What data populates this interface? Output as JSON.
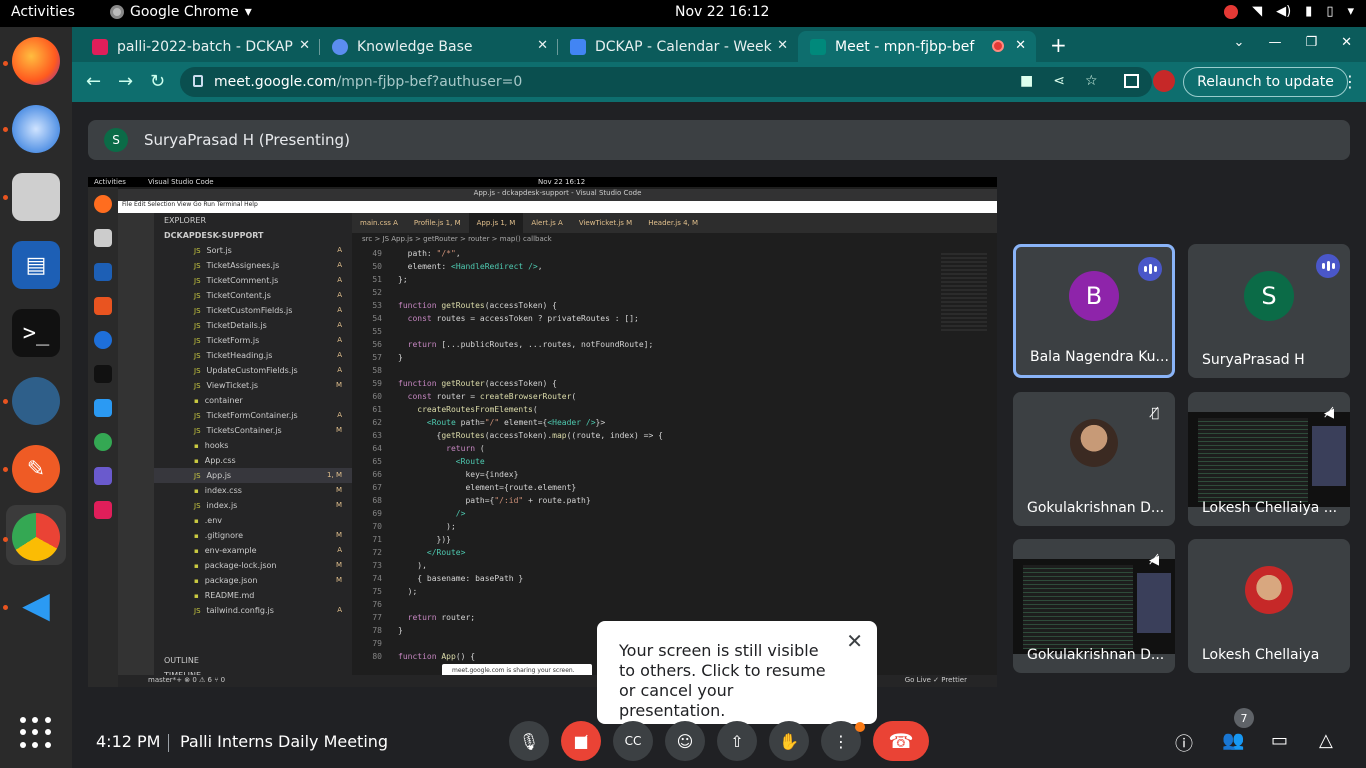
{
  "os": {
    "activities": "Activities",
    "app_name": "Google Chrome",
    "clock": "Nov 22  16:12"
  },
  "browser": {
    "tabs": [
      {
        "title": "palli-2022-batch - DCKAP",
        "color": "#e01e5a"
      },
      {
        "title": "Knowledge Base",
        "color": "#5b8def"
      },
      {
        "title": "DCKAP - Calendar - Week",
        "color": "#4285f4"
      },
      {
        "title": "Meet - mpn-fjbp-bef",
        "color": "#00897b"
      }
    ],
    "url_host": "meet.google.com",
    "url_path": "/mpn-fjbp-bef?authuser=0",
    "relaunch_label": "Relaunch to update"
  },
  "meet": {
    "presenter_initial": "S",
    "presenter_label": "SuryaPrasad H (Presenting)",
    "participants": [
      {
        "name": "Bala Nagendra Ku...",
        "initial": "B",
        "avatar_color": "#8e24aa"
      },
      {
        "name": "SuryaPrasad H",
        "initial": "S",
        "avatar_color": "#0b6b47"
      },
      {
        "name": "Gokulakrishnan D..."
      },
      {
        "name": "Lokesh Chellaiya ..."
      },
      {
        "name": "Gokulakrishnan D..."
      },
      {
        "name": "Lokesh Chellaiya"
      }
    ],
    "popup_text": "Your screen is still visible to others. Click to resume or cancel your presentation.",
    "time": "4:12 PM",
    "meeting_name": "Palli Interns Daily Meeting",
    "participant_count": "7"
  },
  "shared_screen": {
    "top_left": "Activities",
    "app": "Visual Studio Code",
    "clock": "Nov 22  16:12",
    "title": "App.js - dckapdesk-support - Visual Studio Code",
    "menu": "File  Edit  Selection  View  Go  Run  Terminal  Help",
    "explorer_title": "EXPLORER",
    "project": "DCKAPDESK-SUPPORT",
    "files": [
      {
        "name": "Sort.js",
        "status": "A"
      },
      {
        "name": "TicketAssignees.js",
        "status": "A"
      },
      {
        "name": "TicketComment.js",
        "status": "A"
      },
      {
        "name": "TicketContent.js",
        "status": "A"
      },
      {
        "name": "TicketCustomFields.js",
        "status": "A"
      },
      {
        "name": "TicketDetails.js",
        "status": "A"
      },
      {
        "name": "TicketForm.js",
        "status": "A"
      },
      {
        "name": "TicketHeading.js",
        "status": "A"
      },
      {
        "name": "UpdateCustomFields.js",
        "status": "A"
      },
      {
        "name": "ViewTicket.js",
        "status": "M"
      },
      {
        "name": "container",
        "status": ""
      },
      {
        "name": "TicketFormContainer.js",
        "status": "A"
      },
      {
        "name": "TicketsContainer.js",
        "status": "M"
      },
      {
        "name": "hooks",
        "status": ""
      },
      {
        "name": "App.css",
        "status": ""
      },
      {
        "name": "App.js",
        "status": "1, M"
      },
      {
        "name": "index.css",
        "status": "M"
      },
      {
        "name": "index.js",
        "status": "M"
      },
      {
        "name": ".env",
        "status": ""
      },
      {
        "name": ".gitignore",
        "status": "M"
      },
      {
        "name": "env-example",
        "status": "A"
      },
      {
        "name": "package-lock.json",
        "status": "M"
      },
      {
        "name": "package.json",
        "status": "M"
      },
      {
        "name": "README.md",
        "status": ""
      },
      {
        "name": "tailwind.config.js",
        "status": "A"
      }
    ],
    "outline": "OUTLINE",
    "timeline": "TIMELINE",
    "tabs": [
      "main.css A",
      "Profile.js 1, M",
      "App.js 1, M",
      "Alert.js A",
      "ViewTicket.js M",
      "Header.js 4, M"
    ],
    "breadcrumb": "src > JS App.js > getRouter > router > map() callback",
    "status_left": "master*+  ⊗ 0 ⚠ 6  ⑂ 0",
    "status_right": "Go Live   ✓ Prettier",
    "share_notice": "meet.google.com is sharing your screen."
  }
}
